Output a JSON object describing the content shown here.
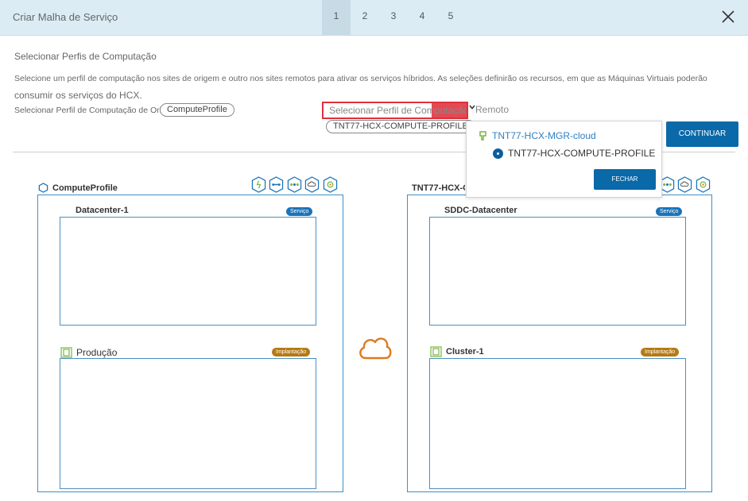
{
  "header": {
    "title": "Criar Malha de Serviço",
    "steps": [
      "1",
      "2",
      "3",
      "4",
      "5"
    ],
    "active_step": "1"
  },
  "section": {
    "title": "Selecionar Perfis de Computação",
    "description_line1": "Selecione um perfil de computação nos sites de origem e outro nos sites remotos para ativar os serviços híbridos. As seleções definirão os recursos, em que as Máquinas Virtuais poderão",
    "description_line2": "consumir os serviços do HCX."
  },
  "source": {
    "label": "Selecionar Perfil de Computação de Origem",
    "selected": "ComputeProfile"
  },
  "remote": {
    "select_placeholder": "Selecionar Perfil de Computação",
    "label": "Remoto",
    "selected": "TNT77-HCX-COMPUTE-PROFILE"
  },
  "buttons": {
    "continue": "CONTINUAR",
    "close_dropdown": "FECHAR"
  },
  "dropdown": {
    "site": "TNT77-HCX-MGR-cloud",
    "profile": "TNT77-HCX-COMPUTE-PROFILE"
  },
  "left_site": {
    "title": "ComputeProfile",
    "datacenter": "Datacenter-1",
    "datacenter_badge": "Serviço",
    "cluster": "Produção",
    "cluster_badge": "Implantação"
  },
  "right_site": {
    "title": "TNT77-HCX-COMPUTE-PROFILE",
    "datacenter": "SDDC-Datacenter",
    "datacenter_badge": "Serviço",
    "cluster": "Cluster-1",
    "cluster_badge": "Implantação"
  },
  "colors": {
    "header_bg": "#dcecf5",
    "primary_button": "#0a69a8",
    "highlight_red": "#e0303b",
    "deployment_badge": "#b57a13",
    "service_badge": "#1a73b8",
    "cloud_icon": "#e07a1f",
    "cluster_icon": "#7cb342"
  },
  "icons": [
    "close-icon",
    "hexagon-icon",
    "cloud-icon",
    "cluster-icon",
    "building-icon",
    "radio-selected-icon",
    "chevron-down-icon",
    "service-icons"
  ]
}
